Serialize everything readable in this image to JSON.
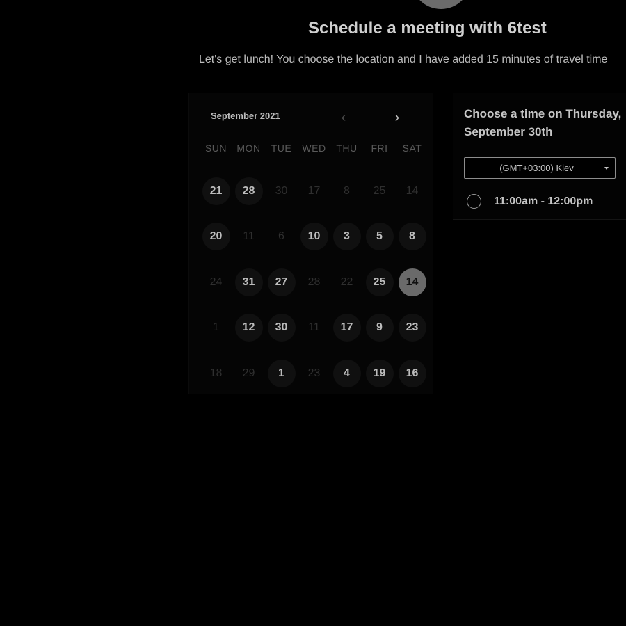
{
  "header": {
    "title": "Schedule a meeting with 6test",
    "subtitle": "Let's get lunch! You choose the location and I have added 15 minutes of travel time"
  },
  "calendar": {
    "month": "September 2021",
    "prev_icon": "chevron-left-icon",
    "next_icon": "chevron-right-icon",
    "weekdays": [
      "SUN",
      "MON",
      "TUE",
      "WED",
      "THU",
      "FRI",
      "SAT"
    ],
    "selected_day": "14",
    "weeks": [
      [
        {
          "label": "21",
          "active": true
        },
        {
          "label": "28",
          "active": true
        },
        {
          "label": "30",
          "active": false
        },
        {
          "label": "17",
          "active": false
        },
        {
          "label": "8",
          "active": false
        },
        {
          "label": "25",
          "active": false
        },
        {
          "label": "14",
          "active": false
        }
      ],
      [
        {
          "label": "20",
          "active": true
        },
        {
          "label": "11",
          "active": false
        },
        {
          "label": "6",
          "active": false
        },
        {
          "label": "10",
          "active": true
        },
        {
          "label": "3",
          "active": true
        },
        {
          "label": "5",
          "active": true
        },
        {
          "label": "8",
          "active": true
        }
      ],
      [
        {
          "label": "24",
          "active": false
        },
        {
          "label": "31",
          "active": true
        },
        {
          "label": "27",
          "active": true
        },
        {
          "label": "28",
          "active": false
        },
        {
          "label": "22",
          "active": false
        },
        {
          "label": "25",
          "active": true
        },
        {
          "label": "14",
          "active": true,
          "selected": true
        }
      ],
      [
        {
          "label": "1",
          "active": false
        },
        {
          "label": "12",
          "active": true
        },
        {
          "label": "30",
          "active": true
        },
        {
          "label": "11",
          "active": false
        },
        {
          "label": "17",
          "active": true
        },
        {
          "label": "9",
          "active": true
        },
        {
          "label": "23",
          "active": true
        }
      ],
      [
        {
          "label": "18",
          "active": false
        },
        {
          "label": "29",
          "active": false
        },
        {
          "label": "1",
          "active": true
        },
        {
          "label": "23",
          "active": false
        },
        {
          "label": "4",
          "active": true
        },
        {
          "label": "19",
          "active": true
        },
        {
          "label": "16",
          "active": true
        }
      ]
    ]
  },
  "time_panel": {
    "heading": "Choose a time on Thursday, September 30th",
    "timezone": "(GMT+03:00) Kiev",
    "slots": [
      {
        "label": "11:00am - 12:00pm"
      }
    ]
  },
  "colors": {
    "background": "#000000",
    "selected_day": "#6a6a6a",
    "text": "#c6c6c6"
  }
}
